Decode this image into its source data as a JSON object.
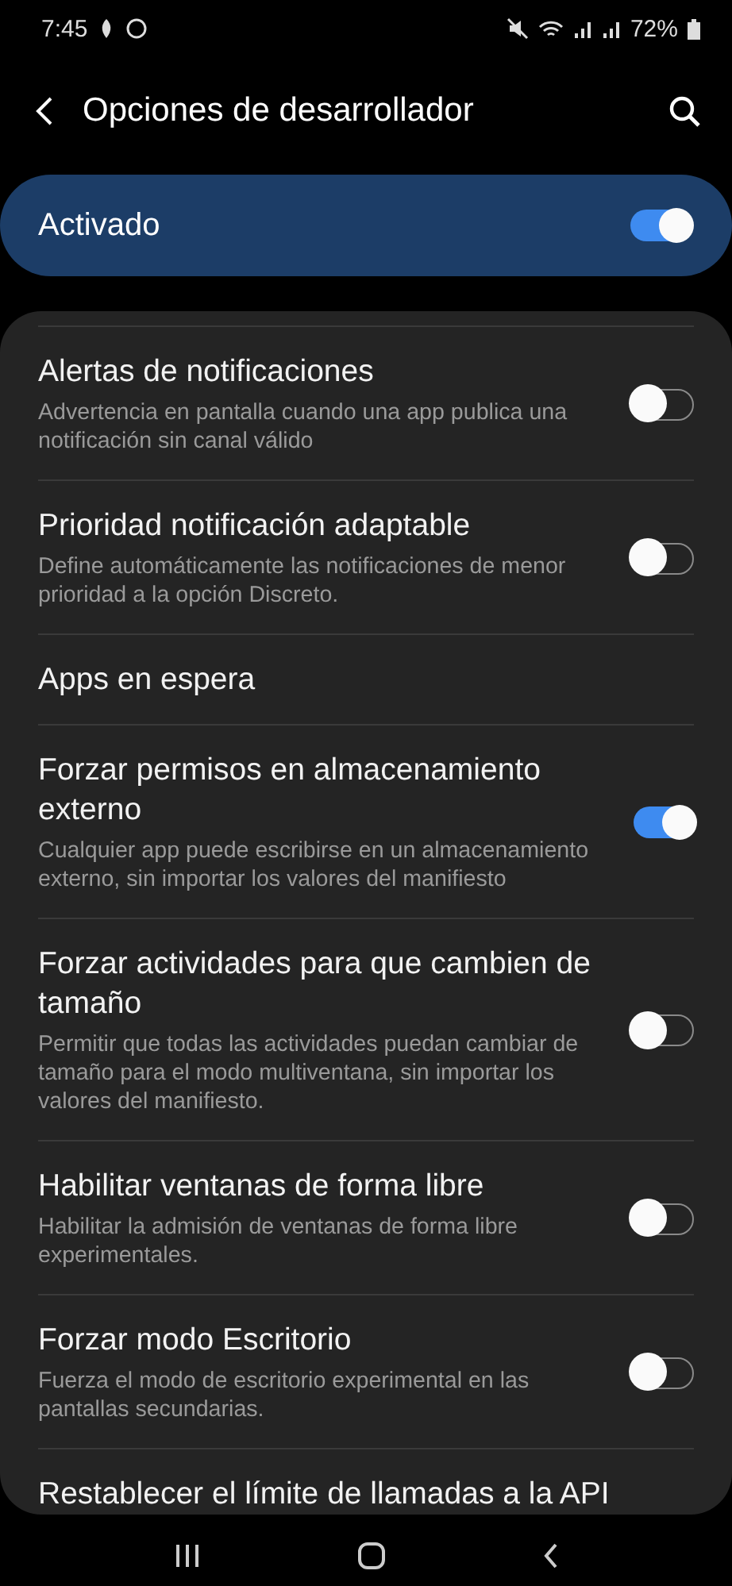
{
  "status_bar": {
    "time": "7:45",
    "battery": "72%"
  },
  "header": {
    "title": "Opciones de desarrollador"
  },
  "master": {
    "label": "Activado",
    "on": true
  },
  "settings": [
    {
      "kind": "toggle",
      "title": "Alertas de notificaciones",
      "summary": "Advertencia en pantalla cuando una app publica una notificación sin canal válido",
      "on": false
    },
    {
      "kind": "toggle",
      "title": "Prioridad notificación adaptable",
      "summary": "Define automáticamente las notificaciones de menor prioridad a la opción Discreto.",
      "on": false
    },
    {
      "kind": "link",
      "title": "Apps en espera"
    },
    {
      "kind": "toggle",
      "title": "Forzar permisos en almacenamiento externo",
      "summary": "Cualquier app puede escribirse en un almacenamiento externo, sin importar los valores del manifiesto",
      "on": true
    },
    {
      "kind": "toggle",
      "title": "Forzar actividades para que cambien de tamaño",
      "summary": "Permitir que todas las actividades puedan cambiar de tamaño para el modo multiventana, sin importar los valores del manifiesto.",
      "on": false
    },
    {
      "kind": "toggle",
      "title": "Habilitar ventanas de forma libre",
      "summary": "Habilitar la admisión de ventanas de forma libre experimentales.",
      "on": false
    },
    {
      "kind": "toggle",
      "title": "Forzar modo Escritorio",
      "summary": "Fuerza el modo de escritorio experimental en las pantallas secundarias.",
      "on": false
    },
    {
      "kind": "link",
      "title": "Restablecer el límite de llamadas a la API"
    }
  ]
}
